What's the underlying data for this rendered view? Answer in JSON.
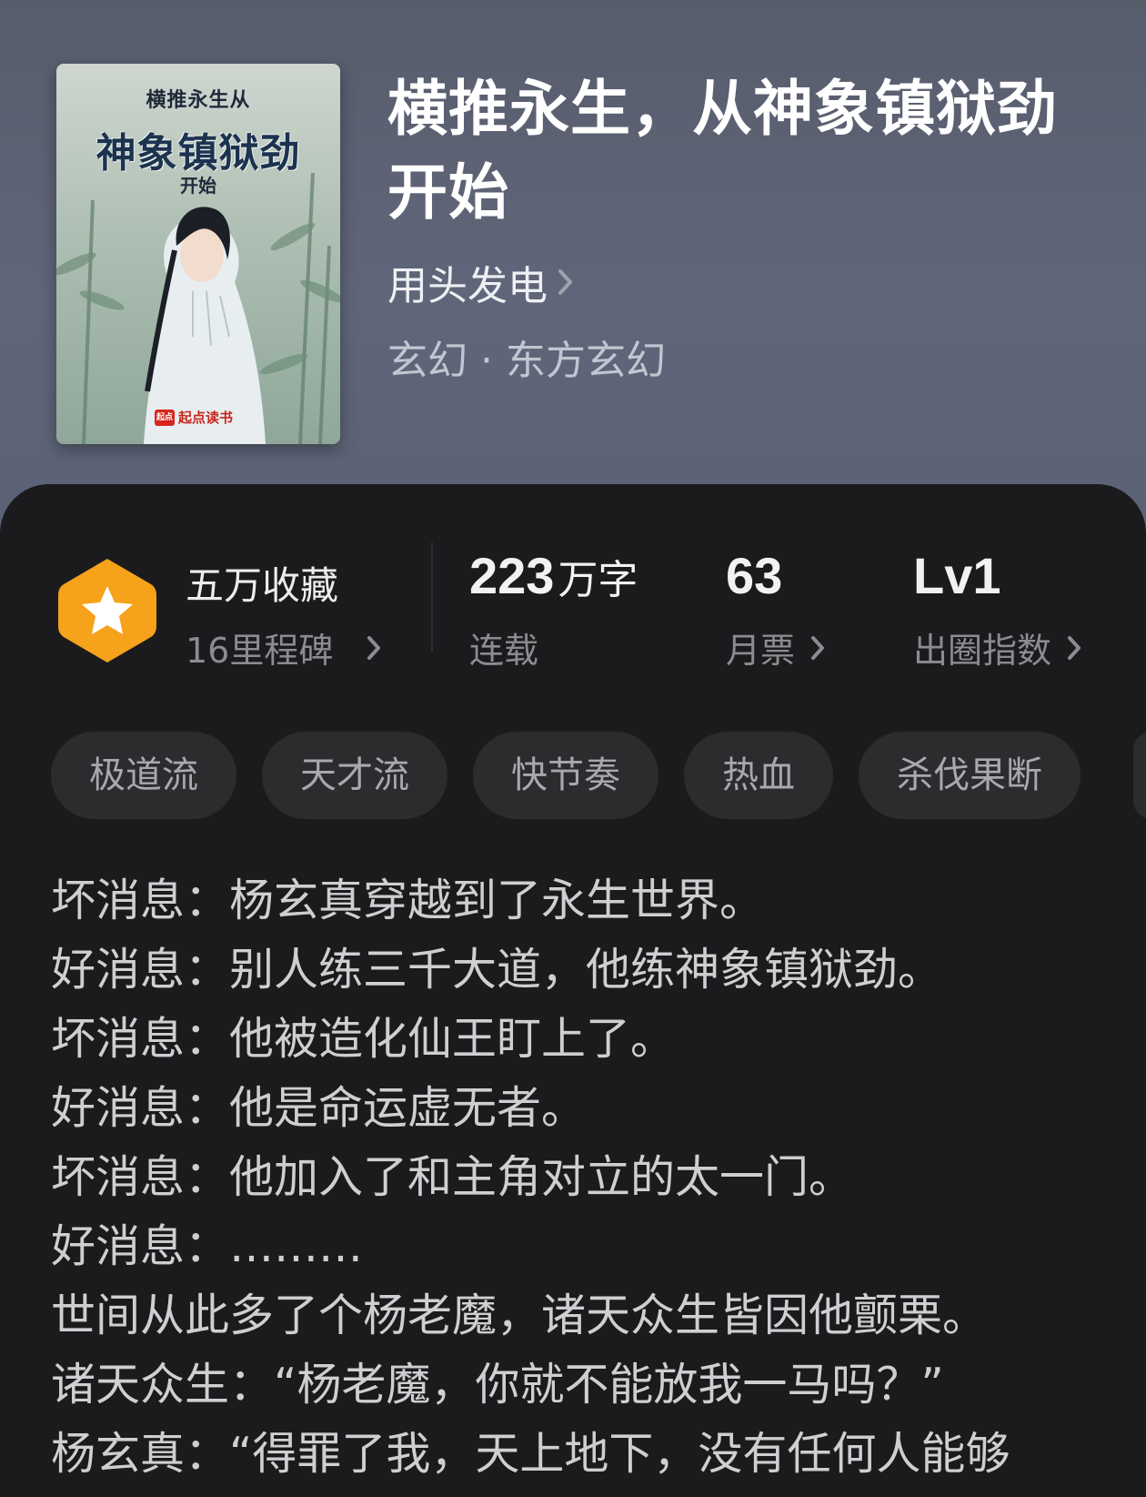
{
  "book": {
    "title": "横推永生，从神象镇狱劲开始",
    "author": "用头发电",
    "genre": "玄幻 · 东方玄幻",
    "cover": {
      "line1": "横推永生从",
      "line2": "神象镇狱劲",
      "line3": "开始",
      "publisher_mark": "起点",
      "publisher": "起点读书"
    }
  },
  "stats": {
    "collect_main": "五万收藏",
    "collect_sub": "16里程碑",
    "words_num": "223",
    "words_unit": "万字",
    "words_sub": "连载",
    "tickets_num": "63",
    "tickets_sub": "月票",
    "level_num": "Lv1",
    "level_sub": "出圈指数"
  },
  "tags": [
    "极道流",
    "天才流",
    "快节奏",
    "热血",
    "杀伐果断"
  ],
  "synopsis": [
    "坏消息：杨玄真穿越到了永生世界。",
    "好消息：别人练三千大道，他练神象镇狱劲。",
    "坏消息：他被造化仙王盯上了。",
    "好消息：他是命运虚无者。",
    "坏消息：他加入了和主角对立的太一门。",
    "好消息：………",
    "世间从此多了个杨老魔，诸天众生皆因他颤栗。",
    "诸天众生：“杨老魔，你就不能放我一马吗？”",
    "杨玄真：“得罪了我，天上地下，没有任何人能够"
  ],
  "colors": {
    "panel_bg": "#1b1b1d",
    "tag_bg": "#2c2c2f",
    "badge_orange": "#f7a21b",
    "header_bg": "#5b6276"
  },
  "icons": {
    "badge": "star-hexagon-icon",
    "chevron": "chevron-right-icon"
  }
}
